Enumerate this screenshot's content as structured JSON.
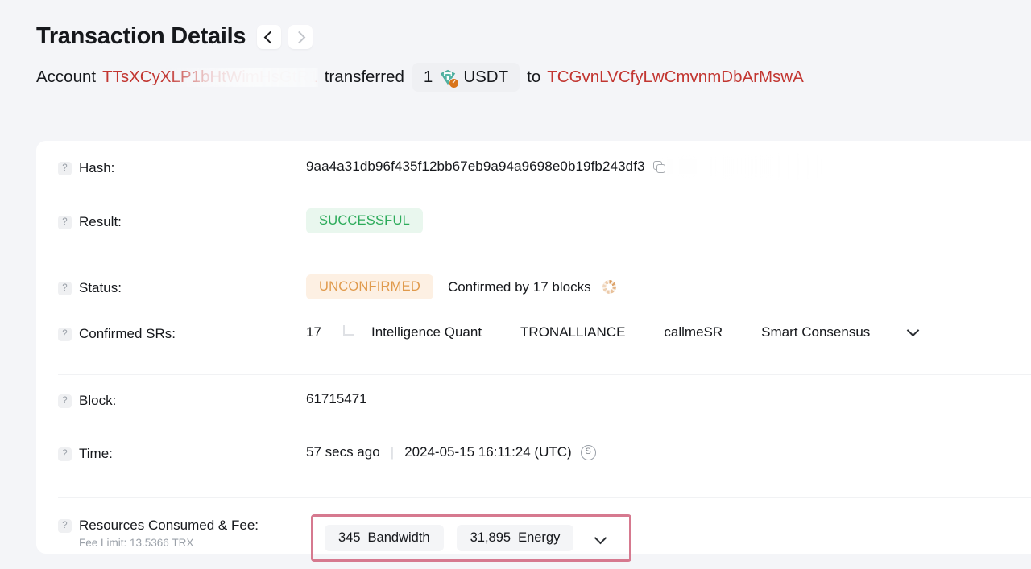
{
  "header": {
    "title": "Transaction Details",
    "prev_button": "‹",
    "next_button": "›"
  },
  "summary": {
    "account_label": "Account",
    "from_address": "TTsXCyXLP1bHtWimHsGtR1",
    "transferred_label": "transferred",
    "amount": "1",
    "token": "USDT",
    "token_icon": "usdt-tether-icon",
    "to_label": "to",
    "to_address": "TCGvnLVCfyLwCmvnmDbArMswA"
  },
  "details": {
    "hash": {
      "label": "Hash:",
      "value": "9aa4a31db96f435f12bb67eb9a94a9698e0b19fb243df3",
      "copy_icon": "copy-icon"
    },
    "result": {
      "label": "Result:",
      "value": "SUCCESSFUL"
    },
    "status": {
      "label": "Status:",
      "badge": "UNCONFIRMED",
      "confirmations": "Confirmed by 17 blocks",
      "spinner_icon": "loading-spinner-icon"
    },
    "confirmed_srs": {
      "label": "Confirmed SRs:",
      "count": "17",
      "names": [
        "Intelligence Quant",
        "TRONALLIANCE",
        "callmeSR",
        "Smart Consensus"
      ],
      "expand_icon": "chevron-down-icon"
    },
    "block": {
      "label": "Block:",
      "value": "61715471"
    },
    "time": {
      "label": "Time:",
      "relative": "57 secs ago",
      "separator": "|",
      "absolute": "2024-05-15 16:11:24 (UTC)",
      "switch_icon": "S"
    },
    "resources": {
      "label": "Resources Consumed & Fee:",
      "fee_limit": "Fee Limit: 13.5366 TRX",
      "bandwidth_value": "345",
      "bandwidth_label": "Bandwidth",
      "energy_value": "31,895",
      "energy_label": "Energy",
      "expand_icon": "chevron-down-icon",
      "highlight_color": "#d6798f"
    }
  },
  "help_icon": "?"
}
